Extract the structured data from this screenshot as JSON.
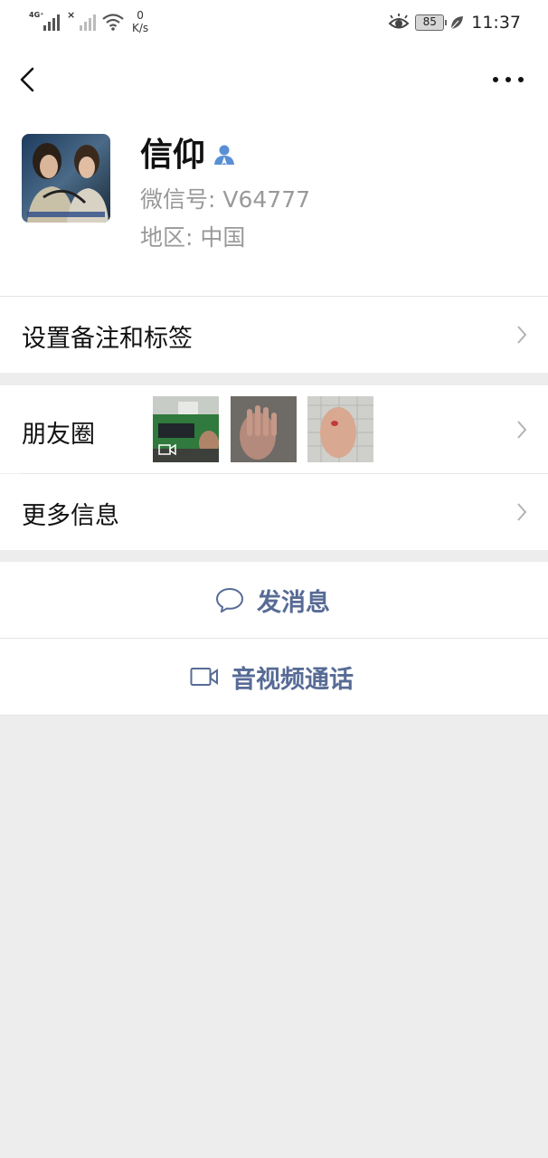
{
  "status_bar": {
    "network_tag": "4G⁺",
    "speed_value": "0",
    "speed_unit": "K/s",
    "battery": "85",
    "time": "11:37"
  },
  "header": {
    "back_icon": "chevron-left-icon",
    "more_icon": "more-horizontal-icon"
  },
  "profile": {
    "name": "信仰",
    "wechat_id": "微信号:  V64777",
    "region": "地区:  中国"
  },
  "rows": {
    "remark_tags": "设置备注和标签",
    "moments": "朋友圈",
    "more_info": "更多信息"
  },
  "actions": {
    "send_message": "发消息",
    "video_call": "音视频通话"
  },
  "colors": {
    "link_blue": "#576b95",
    "page_gray": "#ededed",
    "verify_icon_blue": "#5a8fd6"
  }
}
